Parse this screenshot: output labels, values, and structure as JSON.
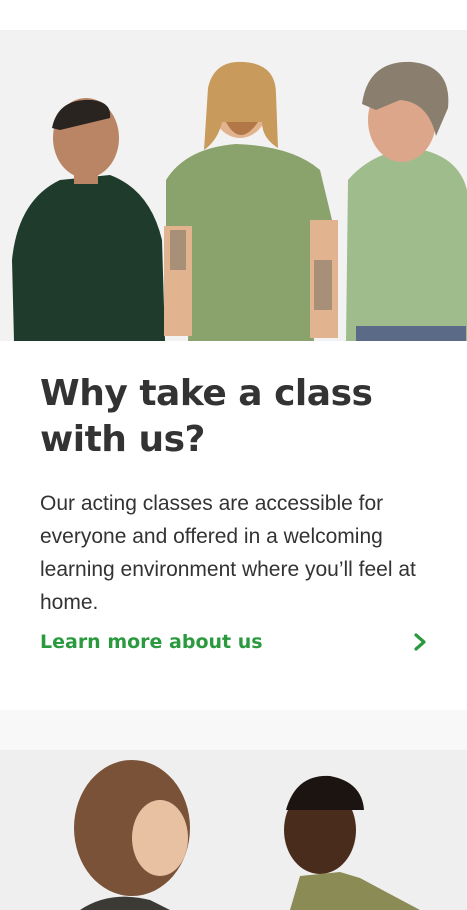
{
  "section": {
    "title": "Why take a class with us?",
    "body": "Our acting classes are accessible for everyone and offered in a welcoming learning environment where you’ll feel at home.",
    "cta_label": "Learn more about us",
    "cta_icon": "chevron-right-icon"
  },
  "colors": {
    "accent": "#2b9a3f",
    "text": "#333333",
    "background": "#ffffff"
  }
}
